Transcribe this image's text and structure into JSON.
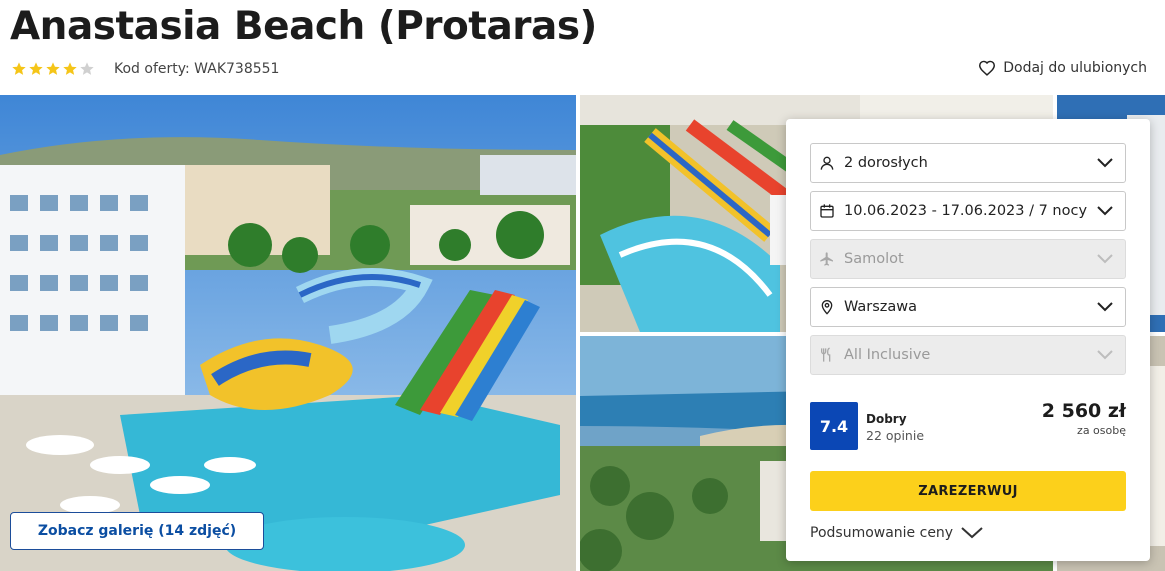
{
  "hotel": {
    "name": "Anastasia Beach (Protaras)",
    "stars": 4,
    "max_stars": 5,
    "offer_code": "Kod oferty: WAK738551",
    "favorite_label": "Dodaj do ulubionych"
  },
  "gallery": {
    "button_label": "Zobacz galerię (14 zdjęć)"
  },
  "booking": {
    "guests": "2 dorosłych",
    "dates": "10.06.2023 - 17.06.2023 / 7 nocy",
    "transport": "Samolot",
    "departure": "Warszawa",
    "board": "All Inclusive",
    "rating": {
      "score": "7.4",
      "label": "Dobry",
      "reviews": "22 opinie"
    },
    "price": "2 560 zł",
    "price_note": "za osobę",
    "reserve_label": "ZAREZERWUJ",
    "summary_label": "Podsumowanie ceny"
  },
  "colors": {
    "accent_blue": "#0b47b5",
    "reserve_yellow": "#fcd01b",
    "star_gold": "#f5c518",
    "star_empty": "#d0d0d0"
  }
}
